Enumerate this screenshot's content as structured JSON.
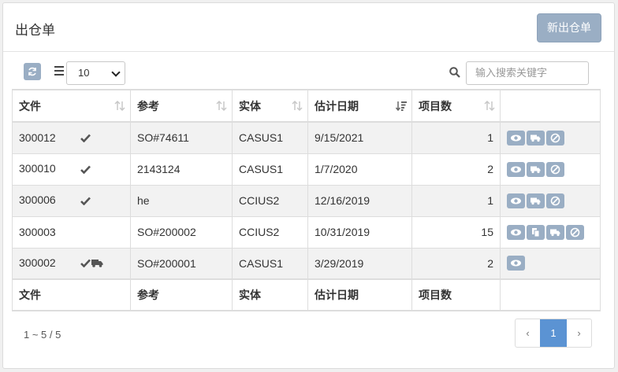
{
  "header": {
    "title": "出仓单",
    "new_button": "新出仓单"
  },
  "toolbar": {
    "page_size": "10",
    "search_placeholder": "输入搜索关键字"
  },
  "columns": [
    "文件",
    "参考",
    "实体",
    "估计日期",
    "项目数"
  ],
  "rows": [
    {
      "file": "300012",
      "status": "check",
      "ref": "SO#74611",
      "entity": "CASUS1",
      "date": "9/15/2021",
      "count": "1",
      "actions": [
        "view-icon",
        "truck-icon",
        "cancel-icon"
      ]
    },
    {
      "file": "300010",
      "status": "check",
      "ref": "2143124",
      "entity": "CASUS1",
      "date": "1/7/2020",
      "count": "2",
      "actions": [
        "view-icon",
        "truck-icon",
        "cancel-icon"
      ]
    },
    {
      "file": "300006",
      "status": "check",
      "ref": "he",
      "entity": "CCIUS2",
      "date": "12/16/2019",
      "count": "1",
      "actions": [
        "view-icon",
        "truck-icon",
        "cancel-icon"
      ]
    },
    {
      "file": "300003",
      "status": "",
      "ref": "SO#200002",
      "entity": "CCIUS2",
      "date": "10/31/2019",
      "count": "15",
      "actions": [
        "view-icon",
        "copy-icon",
        "truck-icon",
        "cancel-icon"
      ]
    },
    {
      "file": "300002",
      "status": "check-truck",
      "ref": "SO#200001",
      "entity": "CASUS1",
      "date": "3/29/2019",
      "count": "2",
      "actions": [
        "view-icon"
      ]
    }
  ],
  "pagination": {
    "info": "1 ~ 5 / 5",
    "prev": "‹",
    "current": "1",
    "next": "›"
  }
}
